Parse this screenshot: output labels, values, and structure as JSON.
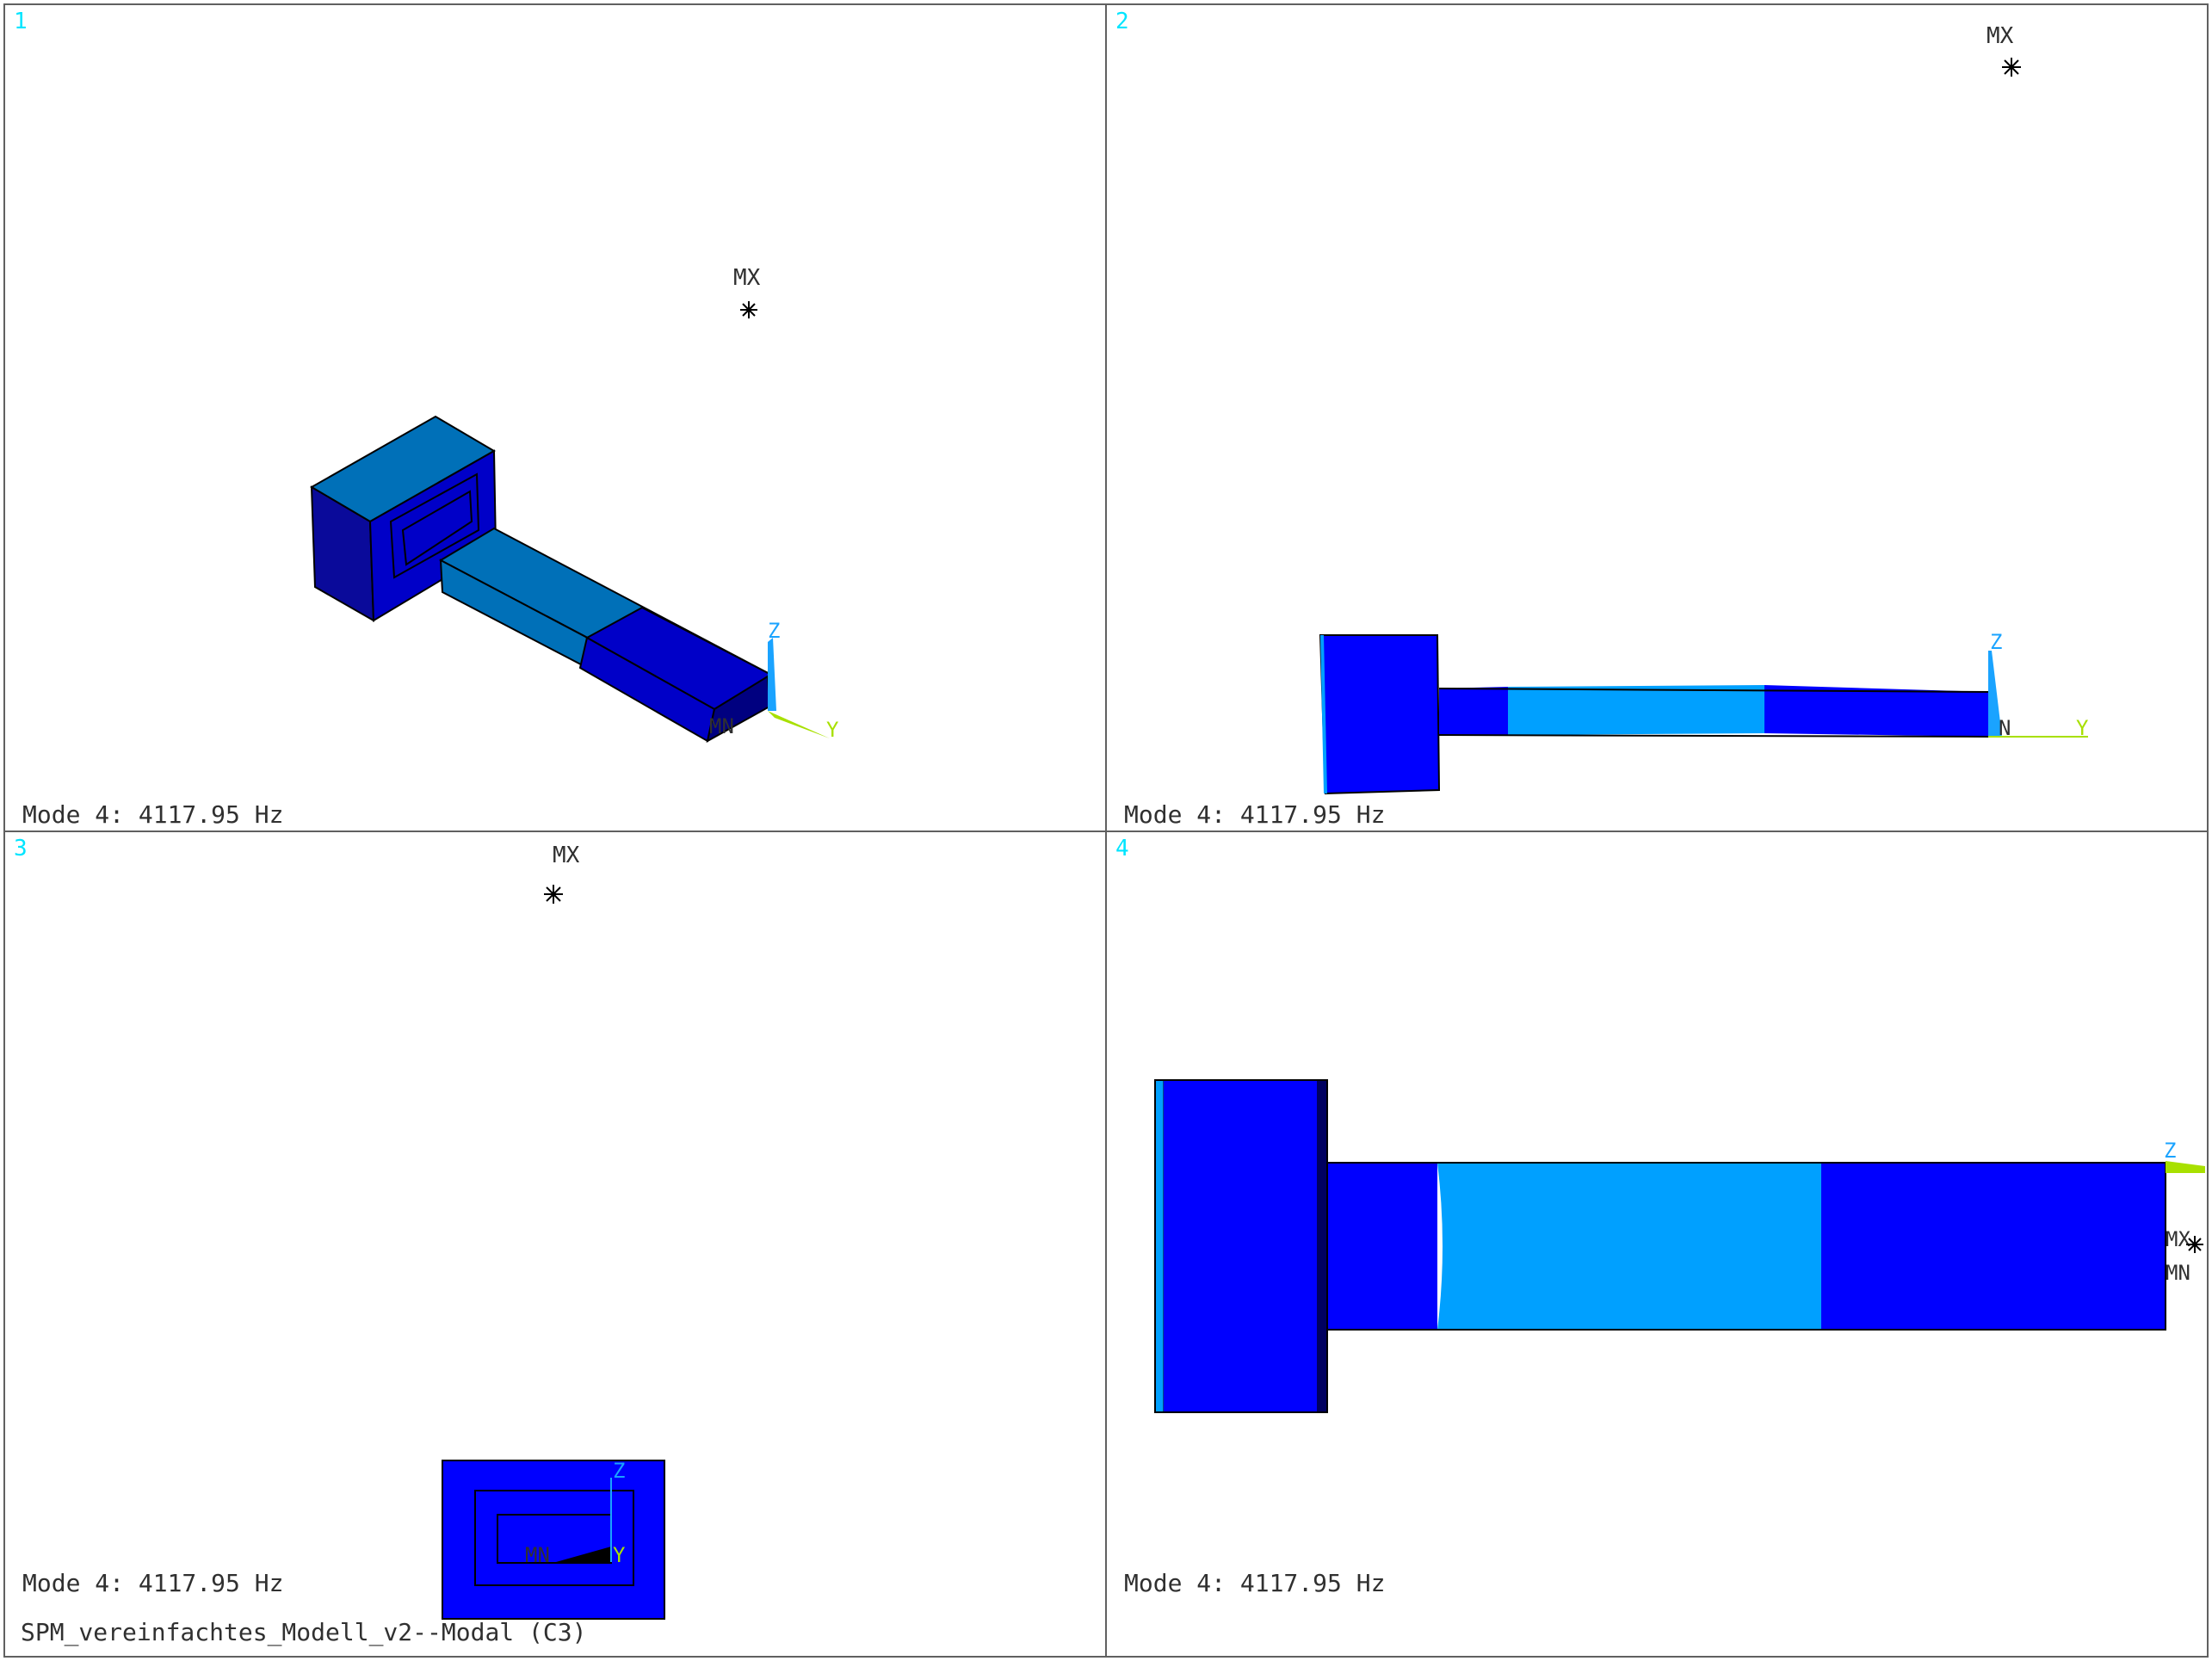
{
  "viewports": [
    {
      "number": "1",
      "caption": "Mode 4: 4117.95 Hz",
      "max_marker": "MX",
      "min_marker": "MN",
      "axis_z": "Z",
      "axis_y": "Y"
    },
    {
      "number": "2",
      "caption": "Mode 4: 4117.95 Hz",
      "max_marker": "MX",
      "min_marker": "N",
      "axis_z": "Z",
      "axis_y": "Y"
    },
    {
      "number": "3",
      "caption": "Mode 4: 4117.95 Hz",
      "max_marker": "MX",
      "min_marker": "MN",
      "axis_z": "Z",
      "axis_y": "Y"
    },
    {
      "number": "4",
      "caption": "Mode 4: 4117.95 Hz",
      "max_marker": "MX",
      "min_marker": "MN",
      "axis_z": "Z",
      "axis_y": ""
    }
  ],
  "footer": "SPM_vereinfachtes_Modell_v2--Modal (C3)",
  "colors": {
    "dark_blue": "#0000c8",
    "navy": "#0a0a9a",
    "blue": "#0000ff",
    "cyan_blue": "#00a0ff",
    "steel_blue": "#0070b8",
    "axis_z": "#1aa3ff",
    "axis_y": "#a8e000",
    "viewport_number": "#00e5ff"
  }
}
